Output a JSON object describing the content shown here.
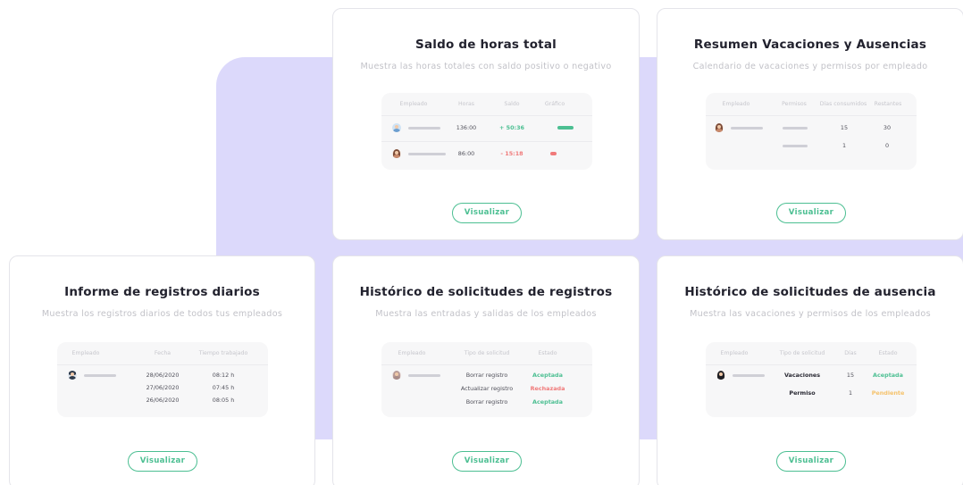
{
  "colors": {
    "accent": "#4cbf92",
    "negative": "#f07a7a",
    "pending": "#f5c26b",
    "background_shape": "#dcd9fb"
  },
  "button_label": "Visualizar",
  "cards": {
    "saldo": {
      "title": "Saldo de horas total",
      "description": "Muestra las horas totales con saldo positivo o negativo",
      "headers": [
        "Empleado",
        "Horas",
        "Saldo",
        "Gráfico"
      ],
      "rows": [
        {
          "hours": "136:00",
          "balance": "+ 50:36",
          "balance_type": "positive",
          "bar_fraction": 0.9
        },
        {
          "hours": "86:00",
          "balance": "- 15:18",
          "balance_type": "negative",
          "bar_fraction": 0.3
        }
      ]
    },
    "vacaciones": {
      "title": "Resumen Vacaciones y Ausencias",
      "description": "Calendario de vacaciones y permisos por empleado",
      "headers": [
        "Empleado",
        "Permisos",
        "Días consumidos",
        "Restantes"
      ],
      "rows": [
        {
          "consumed": "15",
          "remaining": "30"
        },
        {
          "consumed": "1",
          "remaining": "0"
        }
      ]
    },
    "informe": {
      "title": "Informe de registros diarios",
      "description": "Muestra los registros diarios de todos tus empleados",
      "headers": [
        "Empleado",
        "Fecha",
        "Tiempo trabajado"
      ],
      "rows": [
        {
          "date": "28/06/2020",
          "time": "08:12 h"
        },
        {
          "date": "27/06/2020",
          "time": "07:45 h"
        },
        {
          "date": "26/06/2020",
          "time": "08:05 h"
        }
      ]
    },
    "registros": {
      "title": "Histórico de solicitudes de registros",
      "description": "Muestra las entradas y salidas de los empleados",
      "headers": [
        "Empleado",
        "Tipo de solicitud",
        "Estado"
      ],
      "rows": [
        {
          "type": "Borrar registro",
          "status": "Aceptada",
          "status_type": "accepted"
        },
        {
          "type": "Actualizar registro",
          "status": "Rechazada",
          "status_type": "rejected"
        },
        {
          "type": "Borrar registro",
          "status": "Aceptada",
          "status_type": "accepted"
        }
      ]
    },
    "ausencia": {
      "title": "Histórico de solicitudes de ausencia",
      "description": "Muestra las vacaciones y permisos de los empleados",
      "headers": [
        "Empleado",
        "Tipo de solicitud",
        "Días",
        "Estado"
      ],
      "rows": [
        {
          "type": "Vacaciones",
          "days": "15",
          "status": "Aceptada",
          "status_type": "accepted"
        },
        {
          "type": "Permiso",
          "days": "1",
          "status": "Pendiente",
          "status_type": "pending"
        }
      ]
    }
  }
}
